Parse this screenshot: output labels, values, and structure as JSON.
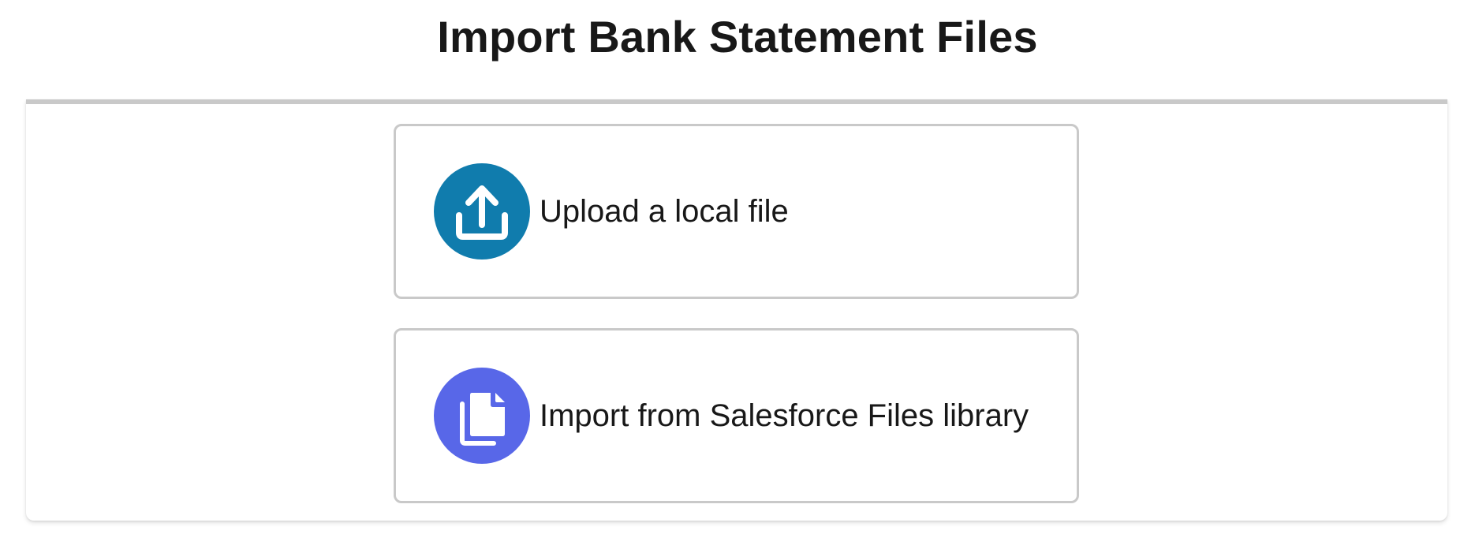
{
  "page": {
    "title": "Import Bank Statement Files"
  },
  "options": [
    {
      "label": "Upload a local file",
      "icon": "upload-icon",
      "icon_color": "#107cad"
    },
    {
      "label": "Import from Salesforce Files library",
      "icon": "files-library-icon",
      "icon_color": "#5867e8"
    }
  ],
  "colors": {
    "panel_top_border": "#c9c9c9",
    "option_border": "#c9c9c9",
    "text": "#181818"
  }
}
